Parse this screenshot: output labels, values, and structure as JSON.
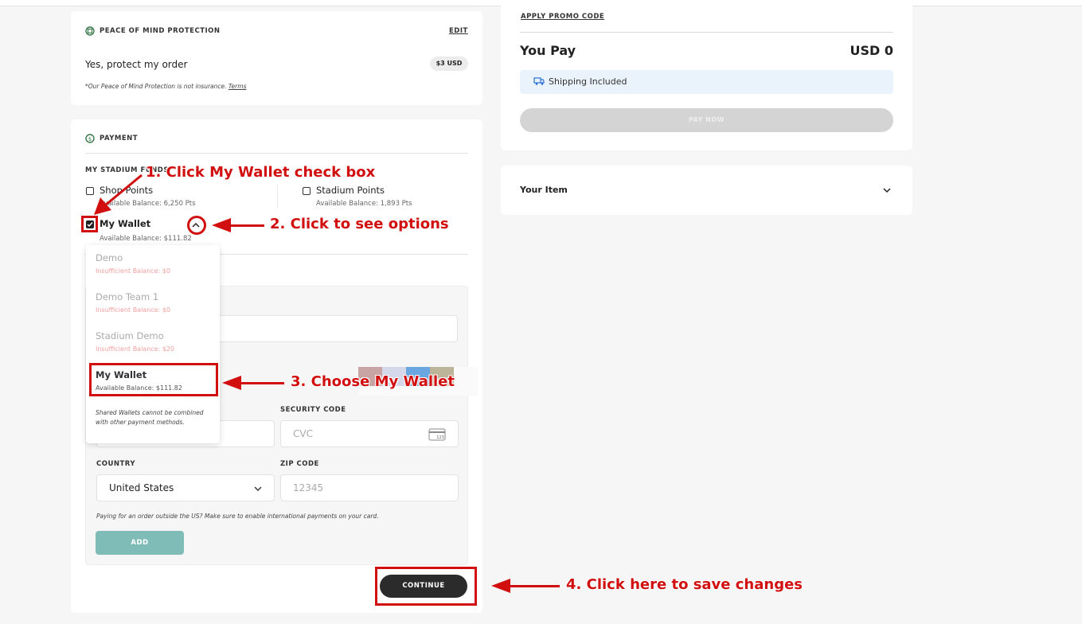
{
  "protection": {
    "title": "PEACE OF MIND PROTECTION",
    "edit": "EDIT",
    "option": "Yes, protect my order",
    "price": "$3 USD",
    "note": "*Our Peace of Mind Protection is not insurance.",
    "terms": "Terms"
  },
  "payment": {
    "title": "PAYMENT",
    "funds_label": "MY STADIUM FUNDS",
    "shop_points": {
      "label": "Shop Points",
      "balance": "Available Balance: 6,250 Pts"
    },
    "stadium_points": {
      "label": "Stadium Points",
      "balance": "Available Balance: 1,893 Pts"
    },
    "wallet": {
      "label": "My Wallet",
      "balance": "Available Balance: $111.82"
    },
    "security_label": "SECURITY CODE",
    "security_placeholder": "CVC",
    "country_label": "COUNTRY",
    "country_value": "United States",
    "zip_label": "ZIP CODE",
    "zip_placeholder": "12345",
    "intl_note": "Paying for an order outside the US? Make sure to enable international payments on your card.",
    "add_button": "ADD",
    "continue_button": "CONTINUE"
  },
  "wallet_dropdown": {
    "items": [
      {
        "name": "Demo",
        "sub": "Insufficient Balance: $0"
      },
      {
        "name": "Demo Team 1",
        "sub": "Insufficient Balance: $0"
      },
      {
        "name": "Stadium Demo",
        "sub": "Insufficient Balance: $20"
      },
      {
        "name": "My Wallet",
        "sub": "Available Balance: $111.82"
      }
    ],
    "note": "Shared Wallets cannot be combined with other payment methods."
  },
  "summary": {
    "promo": "APPLY PROMO CODE",
    "you_pay_label": "You Pay",
    "you_pay_value": "USD 0",
    "shipping": "Shipping Included",
    "pay_now": "PAY NOW",
    "your_item": "Your Item"
  },
  "annotations": {
    "step1": "1. Click My Wallet check box",
    "step2": "2. Click to see options",
    "step3": "3. Choose My Wallet",
    "step4": "4. Click here to save changes"
  },
  "icons": {
    "protection": "shield-icon",
    "payment": "dollar-circle-icon",
    "shipping": "truck-icon",
    "card": "card-icon",
    "chevron": "chevron-down-icon"
  },
  "colors": {
    "accent_red": "#d10f0f",
    "add_button": "#7fbcb8",
    "continue_button": "#2b2b2b",
    "shipping_bg": "#eaf3fc",
    "pay_now_bg": "#d4d4d4"
  }
}
